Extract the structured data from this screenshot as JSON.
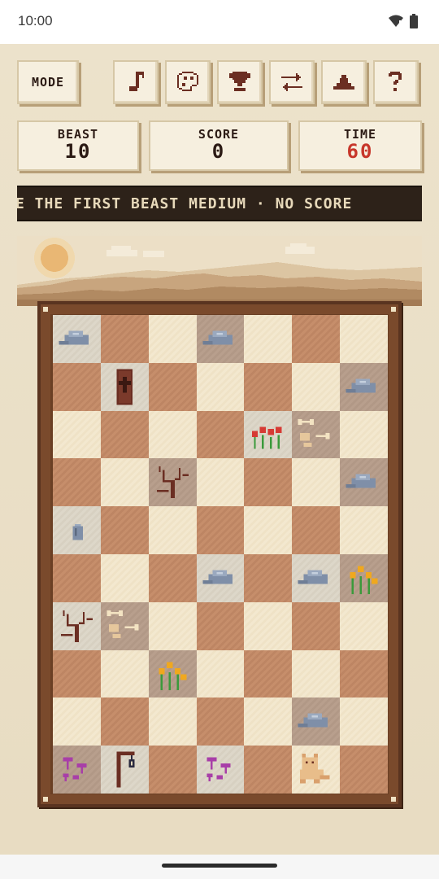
{
  "status_bar": {
    "time": "10:00"
  },
  "toolbar": {
    "mode_label": "MODE",
    "icons": [
      "music-note-icon",
      "palette-icon",
      "trophy-icon",
      "swap-arrows-icon",
      "podium-icon",
      "help-question-icon"
    ]
  },
  "stats": {
    "beast": {
      "label": "BEAST",
      "value": "10"
    },
    "score": {
      "label": "SCORE",
      "value": "0"
    },
    "time": {
      "label": "TIME",
      "value": "60",
      "color": "#c7362a"
    }
  },
  "ticker": {
    "text": "E  THE FIRST BEAST MEDIUM · NO SCORE"
  },
  "board": {
    "cols": 7,
    "rows": 10,
    "tiles": [
      {
        "r": 0,
        "c": 0,
        "piece": "rock",
        "fog": true
      },
      {
        "r": 0,
        "c": 3,
        "piece": "rock",
        "fog": true
      },
      {
        "r": 1,
        "c": 1,
        "piece": "coffin",
        "fog": true
      },
      {
        "r": 1,
        "c": 6,
        "piece": "rock",
        "fog": true
      },
      {
        "r": 2,
        "c": 4,
        "piece": "red-flowers",
        "fog": true
      },
      {
        "r": 2,
        "c": 5,
        "piece": "bones",
        "fog": true
      },
      {
        "r": 3,
        "c": 2,
        "piece": "dead-bush",
        "fog": true
      },
      {
        "r": 3,
        "c": 6,
        "piece": "rock",
        "fog": true
      },
      {
        "r": 4,
        "c": 0,
        "piece": "gravestone",
        "fog": true
      },
      {
        "r": 5,
        "c": 3,
        "piece": "rock",
        "fog": true
      },
      {
        "r": 5,
        "c": 5,
        "piece": "rock",
        "fog": true
      },
      {
        "r": 5,
        "c": 6,
        "piece": "yellow-flowers",
        "fog": true
      },
      {
        "r": 6,
        "c": 0,
        "piece": "dead-bush",
        "fog": true
      },
      {
        "r": 6,
        "c": 1,
        "piece": "bones",
        "fog": true
      },
      {
        "r": 7,
        "c": 2,
        "piece": "yellow-flowers",
        "fog": true
      },
      {
        "r": 8,
        "c": 5,
        "piece": "rock",
        "fog": true
      },
      {
        "r": 9,
        "c": 0,
        "piece": "mushrooms",
        "fog": true
      },
      {
        "r": 9,
        "c": 1,
        "piece": "lantern-post",
        "fog": true
      },
      {
        "r": 9,
        "c": 3,
        "piece": "mushrooms",
        "fog": true
      },
      {
        "r": 9,
        "c": 5,
        "piece": "beast",
        "fog": false
      }
    ]
  },
  "colors": {
    "background": "#ece2cc",
    "frame": "#7a4a2c",
    "light_square": "#f3e8cf",
    "dark_square": "#c68e6b",
    "ticker_bg": "#2d2219",
    "accent_red": "#c7362a"
  }
}
